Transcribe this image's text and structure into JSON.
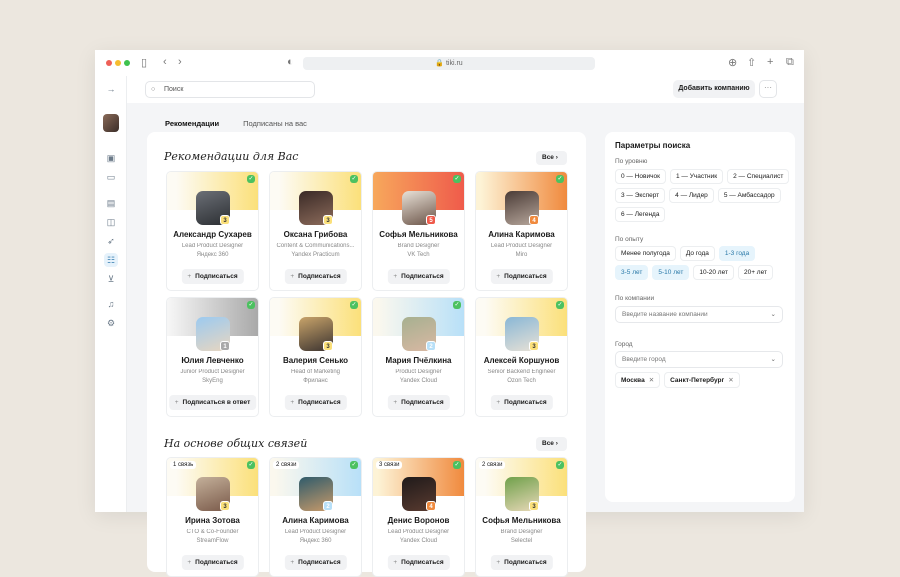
{
  "browser": {
    "url": "tiki.ru"
  },
  "toolbar": {
    "search_placeholder": "Поиск",
    "add_company": "Добавить компанию",
    "more": "···"
  },
  "tabs": [
    {
      "label": "Рекомендации",
      "active": true
    },
    {
      "label": "Подписаны на вас",
      "active": false
    }
  ],
  "sections": [
    {
      "title": "Рекомендации для Вас",
      "all": "Все",
      "cards": [
        {
          "name": "Александр Сухарев",
          "role": "Lead Product Designer",
          "company": "Яндекс 360",
          "level": "3",
          "theme": "yellow",
          "button": "Подписаться"
        },
        {
          "name": "Оксана Грибова",
          "role": "Content & Communications...",
          "company": "Yandex Practicum",
          "level": "3",
          "theme": "yellow",
          "button": "Подписаться"
        },
        {
          "name": "Софья Мельникова",
          "role": "Brand Designer",
          "company": "VK Tech",
          "level": "5",
          "theme": "red",
          "button": "Подписаться"
        },
        {
          "name": "Алина Каримова",
          "role": "Lead Product Designer",
          "company": "Miro",
          "level": "4",
          "theme": "orange",
          "button": "Подписаться"
        },
        {
          "name": "Юлия Левченко",
          "role": "Junior Product Designer",
          "company": "SkyEng",
          "level": "1",
          "theme": "gray",
          "button": "Подписаться в ответ"
        },
        {
          "name": "Валерия Сенько",
          "role": "Head of Marketing",
          "company": "Фриланс",
          "level": "3",
          "theme": "yellow",
          "button": "Подписаться"
        },
        {
          "name": "Мария Пчёлкина",
          "role": "Product Designer",
          "company": "Yandex Cloud",
          "level": "2",
          "theme": "blue",
          "button": "Подписаться"
        },
        {
          "name": "Алексей Коршунов",
          "role": "Senior Backend Engineer",
          "company": "Ozon Tech",
          "level": "3",
          "theme": "yellow",
          "button": "Подписаться"
        }
      ]
    },
    {
      "title": "На основе общих связей",
      "all": "Все",
      "cards": [
        {
          "name": "Ирина Зотова",
          "role": "CTO & Co-Founder",
          "company": "StreamFlow",
          "level": "3",
          "theme": "yellow",
          "connections": "1 связь",
          "button": "Подписаться"
        },
        {
          "name": "Алина Каримова",
          "role": "Lead Product Designer",
          "company": "Яндекс 360",
          "level": "2",
          "theme": "blue",
          "connections": "2 связи",
          "button": "Подписаться"
        },
        {
          "name": "Денис Воронов",
          "role": "Lead Product Designer",
          "company": "Yandex Cloud",
          "level": "4",
          "theme": "orange",
          "connections": "3 связи",
          "button": "Подписаться"
        },
        {
          "name": "Софья Мельникова",
          "role": "Brand Designer",
          "company": "Selectel",
          "level": "3",
          "theme": "yellow",
          "connections": "2 связи",
          "button": "Подписаться"
        }
      ]
    }
  ],
  "filters": {
    "title": "Параметры поиска",
    "level_label": "По уровню",
    "levels": [
      {
        "label": "0 — Новичок"
      },
      {
        "label": "1 — Участник"
      },
      {
        "label": "2 — Специалист"
      },
      {
        "label": "3 — Эксперт"
      },
      {
        "label": "4 — Лидер"
      },
      {
        "label": "5 — Амбассадор"
      },
      {
        "label": "6 — Легенда"
      }
    ],
    "exp_label": "По опыту",
    "experience": [
      {
        "label": "Менее полугода",
        "selected": false
      },
      {
        "label": "До года",
        "selected": false
      },
      {
        "label": "1-3 года",
        "selected": true
      },
      {
        "label": "3-5 лет",
        "selected": true
      },
      {
        "label": "5-10 лет",
        "selected": true
      },
      {
        "label": "10-20 лет",
        "selected": false
      },
      {
        "label": "20+ лет",
        "selected": false
      }
    ],
    "company_label": "По компании",
    "company_placeholder": "Введите название компании",
    "city_label": "Город",
    "city_placeholder": "Введите город",
    "cities": [
      "Москва",
      "Санкт-Петербург"
    ]
  },
  "colors": {
    "yellow": "#fbe07a",
    "red": "#ef5b4b",
    "orange": "#f08a3e",
    "gray": "#a9a9a9",
    "blue": "#b8e0f8",
    "check": "#4cc160"
  }
}
